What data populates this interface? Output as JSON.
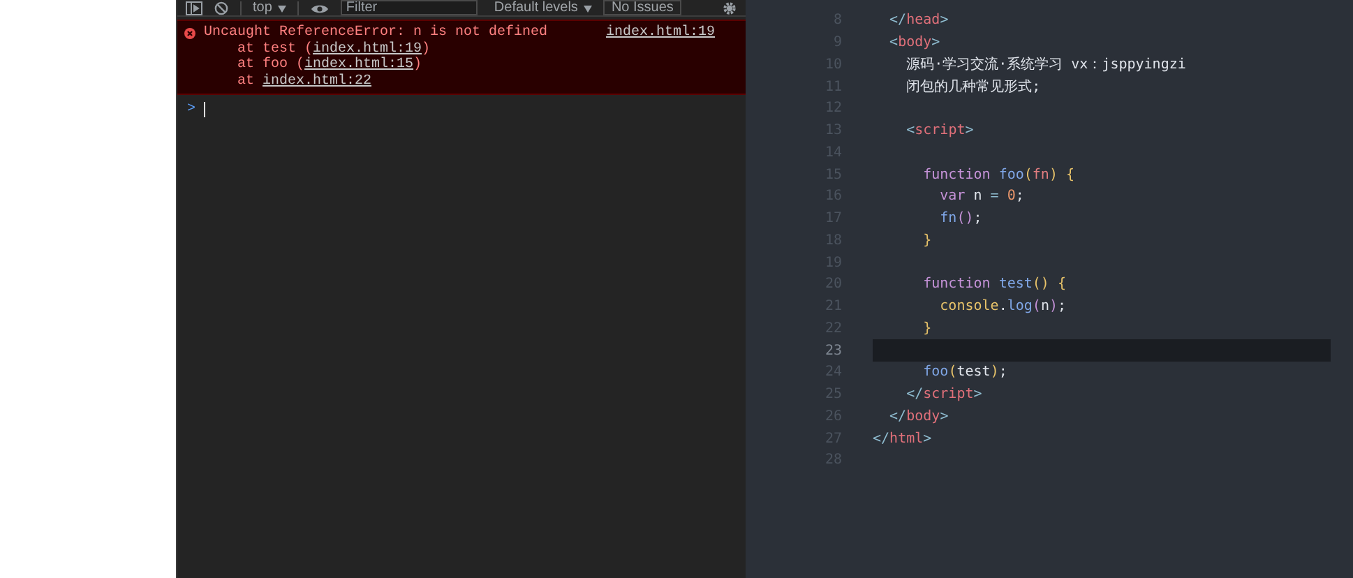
{
  "console": {
    "toolbar": {
      "context": "top",
      "filter_placeholder": "Filter",
      "levels": "Default levels",
      "issues": "No Issues"
    },
    "error": {
      "message": "Uncaught ReferenceError: n is not defined",
      "source": "index.html:19",
      "stack": [
        {
          "prefix": "at test (",
          "link": "index.html:19",
          "suffix": ")"
        },
        {
          "prefix": "at foo (",
          "link": "index.html:15",
          "suffix": ")"
        },
        {
          "prefix": "at ",
          "link": "index.html:22"
        }
      ]
    },
    "prompt": ">"
  },
  "editor": {
    "lines": [
      {
        "number": "8",
        "current": false,
        "tokens": [
          {
            "kind": "bracket",
            "text": "  </"
          },
          {
            "kind": "tag",
            "text": "head"
          },
          {
            "kind": "bracket",
            "text": ">"
          }
        ]
      },
      {
        "number": "9",
        "current": false,
        "tokens": [
          {
            "kind": "bracket",
            "text": "  <"
          },
          {
            "kind": "tag",
            "text": "body"
          },
          {
            "kind": "bracket",
            "text": ">"
          }
        ]
      },
      {
        "number": "10",
        "current": false,
        "tokens": [
          {
            "kind": "plain",
            "text": "    源码·学习交流·系统学习 vx：jsppyingzi"
          }
        ]
      },
      {
        "number": "11",
        "current": false,
        "tokens": [
          {
            "kind": "plain",
            "text": "    闭包的几种常见形式;"
          }
        ]
      },
      {
        "number": "12",
        "current": false
      },
      {
        "number": "13",
        "current": false,
        "tokens": [
          {
            "kind": "bracket",
            "text": "    <"
          },
          {
            "kind": "tag",
            "text": "script"
          },
          {
            "kind": "bracket",
            "text": ">"
          }
        ]
      },
      {
        "number": "14",
        "current": false
      },
      {
        "number": "15",
        "current": false,
        "tokens": [
          {
            "kind": "keyword",
            "text": "      function "
          },
          {
            "kind": "func",
            "text": "foo"
          },
          {
            "kind": "brace",
            "text": "("
          },
          {
            "kind": "param",
            "text": "fn"
          },
          {
            "kind": "brace",
            "text": ") {"
          }
        ]
      },
      {
        "number": "16",
        "current": false,
        "tokens": [
          {
            "kind": "keyword",
            "text": "        var "
          },
          {
            "kind": "plain",
            "text": "n "
          },
          {
            "kind": "bracket",
            "text": "= "
          },
          {
            "kind": "number",
            "text": "0"
          },
          {
            "kind": "plain",
            "text": ";"
          }
        ]
      },
      {
        "number": "17",
        "current": false,
        "tokens": [
          {
            "kind": "func",
            "text": "        fn"
          },
          {
            "kind": "paren",
            "text": "()"
          },
          {
            "kind": "plain",
            "text": ";"
          }
        ]
      },
      {
        "number": "18",
        "current": false,
        "tokens": [
          {
            "kind": "brace",
            "text": "      }"
          }
        ]
      },
      {
        "number": "19",
        "current": false
      },
      {
        "number": "20",
        "current": false,
        "tokens": [
          {
            "kind": "keyword",
            "text": "      function "
          },
          {
            "kind": "func",
            "text": "test"
          },
          {
            "kind": "brace",
            "text": "() {"
          }
        ]
      },
      {
        "number": "21",
        "current": false,
        "tokens": [
          {
            "kind": "object",
            "text": "        console"
          },
          {
            "kind": "plain",
            "text": "."
          },
          {
            "kind": "func",
            "text": "log"
          },
          {
            "kind": "paren",
            "text": "("
          },
          {
            "kind": "plain",
            "text": "n"
          },
          {
            "kind": "paren",
            "text": ")"
          },
          {
            "kind": "plain",
            "text": ";"
          }
        ]
      },
      {
        "number": "22",
        "current": false,
        "tokens": [
          {
            "kind": "brace",
            "text": "      }"
          }
        ]
      },
      {
        "number": "23",
        "current": true
      },
      {
        "number": "24",
        "current": false,
        "tokens": [
          {
            "kind": "func",
            "text": "      foo"
          },
          {
            "kind": "brace",
            "text": "("
          },
          {
            "kind": "plain",
            "text": "test"
          },
          {
            "kind": "brace",
            "text": ")"
          },
          {
            "kind": "plain",
            "text": ";"
          }
        ]
      },
      {
        "number": "25",
        "current": false,
        "tokens": [
          {
            "kind": "bracket",
            "text": "    </"
          },
          {
            "kind": "tag",
            "text": "script"
          },
          {
            "kind": "bracket",
            "text": ">"
          }
        ]
      },
      {
        "number": "26",
        "current": false,
        "tokens": [
          {
            "kind": "bracket",
            "text": "  </"
          },
          {
            "kind": "tag",
            "text": "body"
          },
          {
            "kind": "bracket",
            "text": ">"
          }
        ]
      },
      {
        "number": "27",
        "current": false,
        "tokens": [
          {
            "kind": "bracket",
            "text": "</"
          },
          {
            "kind": "tag",
            "text": "html"
          },
          {
            "kind": "bracket",
            "text": ">"
          }
        ]
      },
      {
        "number": "28",
        "current": false
      }
    ]
  }
}
